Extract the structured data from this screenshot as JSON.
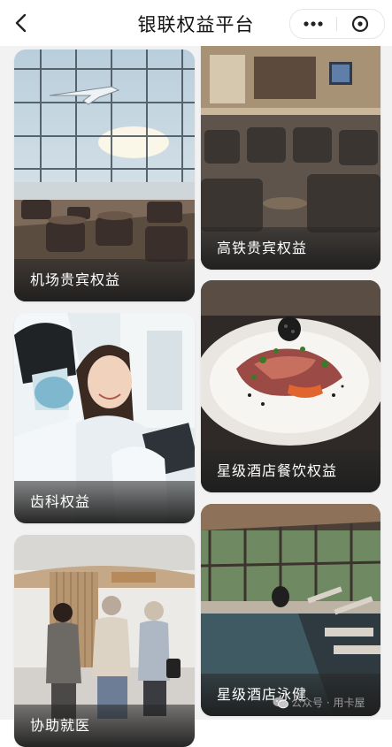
{
  "header": {
    "title": "银联权益平台",
    "back_icon": "chevron-left-icon",
    "more_icon": "more-dots-icon",
    "close_icon": "close-circle-icon"
  },
  "cards": [
    {
      "label": "机场贵宾权益",
      "image": "airport-lounge-photo"
    },
    {
      "label": "高铁贵宾权益",
      "image": "train-lounge-photo"
    },
    {
      "label": "齿科权益",
      "image": "dental-clinic-photo"
    },
    {
      "label": "星级酒店餐饮权益",
      "image": "fine-dining-photo"
    },
    {
      "label": "协助就医",
      "image": "hospital-escort-photo"
    },
    {
      "label": "星级酒店泳健",
      "image": "hotel-pool-photo"
    }
  ],
  "watermark": {
    "text": "公众号 · 用卡屋",
    "icon": "wechat-icon"
  }
}
